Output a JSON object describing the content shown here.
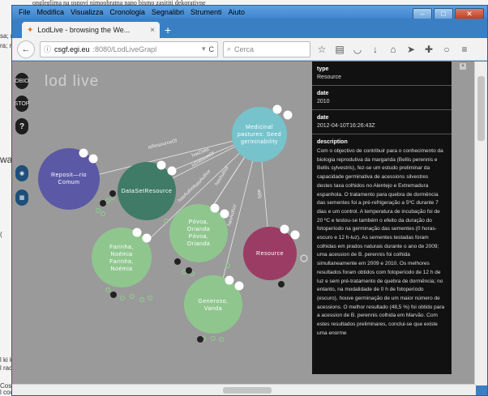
{
  "background": {
    "top_text": "ongleglima na osnovi nimoobratna nano bismo zasititi dekorativne",
    "fragments": [
      "sa; n",
      "ra; r",
      "wa",
      "(",
      "l ki k",
      "l rac",
      "Coso",
      "l coc"
    ]
  },
  "window": {
    "menu": [
      "File",
      "Modifica",
      "Visualizza",
      "Cronologia",
      "Segnalibri",
      "Strumenti",
      "Aiuto"
    ],
    "controls": {
      "minimize": "–",
      "maximize": "□",
      "close": "✕"
    }
  },
  "tab": {
    "title": "LodLive - browsing the We...",
    "close": "×",
    "new": "+"
  },
  "nav": {
    "back": "←",
    "url_host": "csgf.egi.eu",
    "url_rest": ":8080/LodLiveGrapl",
    "reload": "C",
    "search_placeholder": "Cerca",
    "icons": [
      "star-icon",
      "reading-list-icon",
      "pocket-icon",
      "download-icon",
      "home-icon",
      "send-icon",
      "extension-icon",
      "chat-icon",
      "menu-icon"
    ]
  },
  "app": {
    "logo": "lod live",
    "side_buttons": [
      {
        "label": "OBIO",
        "icon": "side-obio-icon"
      },
      {
        "label": "STOP",
        "icon": "side-stop-icon"
      },
      {
        "label": "?",
        "icon": "help-icon"
      },
      {
        "label": "",
        "icon": "location-icon"
      },
      {
        "label": "",
        "icon": "graph-icon"
      }
    ]
  },
  "graph": {
    "nodes": [
      {
        "id": "medicinal",
        "label": "Medicinal pastures: Seed germinability",
        "color": "#76c3cc"
      },
      {
        "id": "repositorio",
        "label": "Reposit—rio Comum",
        "color": "#5b58a6"
      },
      {
        "id": "dataset",
        "label": "DataSetResource",
        "color": "#3f7b66"
      },
      {
        "id": "povoa",
        "label": "Póvoa, Orianda Póvoa, Orianda",
        "color": "#8fc68e"
      },
      {
        "id": "resource",
        "label": "Resource",
        "color": "#9a3c63"
      },
      {
        "id": "farinha",
        "label": "Farinha, Noémia Farinha, Noémia",
        "color": "#8fc68e"
      },
      {
        "id": "generoso",
        "label": "Generoso, Vanda",
        "color": "#8fc68e"
      }
    ],
    "edge_labels": [
      "isResourceOf",
      "hasData",
      "isDatasetOf",
      "hasAuthor",
      "hasAuthor",
      "hasAuthor",
      "type",
      "hasAuthor"
    ]
  },
  "panel": {
    "blocks": [
      {
        "key": "type",
        "value": "Resource"
      },
      {
        "key": "date",
        "value": "2010"
      },
      {
        "key": "date",
        "value": "2012-04-10T16:26:43Z"
      }
    ],
    "description_key": "description",
    "description": "Com o objectivo de contribuir para o conhecimento da biologia reprodutiva da margarida (Bellis perennis e Bellis sylvestris), fez-se um estudo preliminar da capacidade germinativa de acessions silvestres destes taxa colhidos no Alentejo e Extremadura espanhola. O tratamento para quebra de dormência das sementes foi a pré-refrigeração a 5ºC durante 7 dias e um control. A temperatura de incubação foi de 20 ºC e testou-se também o efeito da duração do fotoperíodo na germinação das sementes (0 horas-escuro e 12 h-luz). As sementes testadas foram colhidas em prados naturais durante o ano de 2009; uma acession de B. perennis foi colhida simultaneamente em 2009 e 2010. Os melhores resultados foram obtidos com fotoperíodo de 12 h de luz e sem pré-tratamento de quebra de dormência; no entanto, na modalidade de 0 h de fotoperíodo (escuro), houve germinação de um maior número de acessions. O melhor resultado (48,5 %) foi obtido para a acession de B. perennis colhida em Marvão. Com estes resultados preliminares, conclui-se que existe uma enorme"
  }
}
